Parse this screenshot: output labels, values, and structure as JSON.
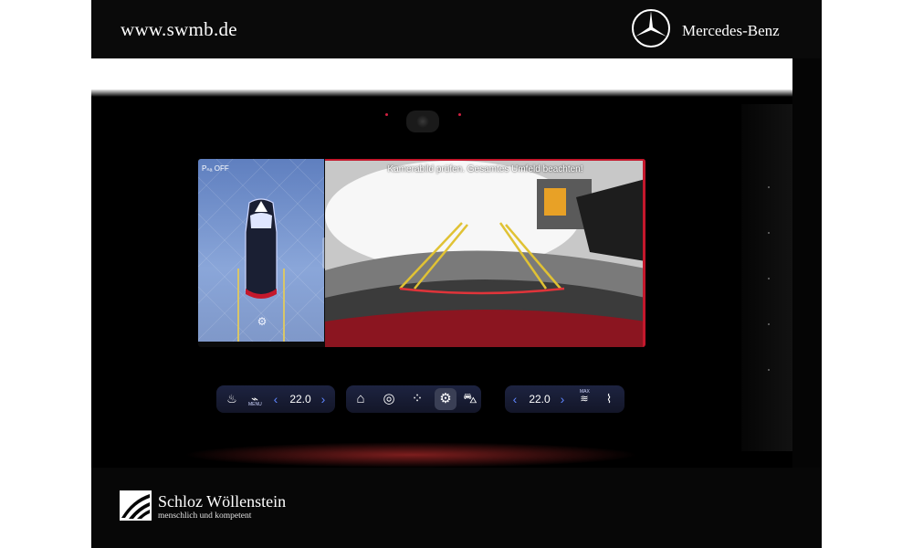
{
  "header": {
    "site_url": "www.swmb.de",
    "brand_name": "Mercedes-Benz",
    "brand_logo_icon": "three-pointed-star-icon"
  },
  "display": {
    "park_label": "Pₙₐ OFF",
    "park_assist_icon": "parking-assist-icon",
    "camera_warning": "Kamerabild prüfen. Gesamtes Umfeld beachten!",
    "toggle_icon": "chevron-left-icon",
    "accent_color": "#c4182c"
  },
  "climate": {
    "left_seat_icon": "seat-heat-icon",
    "menu_label": "MENU",
    "left_temp": "22.0",
    "right_temp": "22.0",
    "right_fan_label": "MAX",
    "right_fan_icon": "defrost-icon",
    "right_seat_icon": "seat-icon",
    "decrease_icon": "chevron-left-icon",
    "increase_icon": "chevron-right-icon"
  },
  "dock": {
    "home_icon": "home-icon",
    "color_wheel_icon": "ambient-light-icon",
    "apps_icon": "apps-icon",
    "settings_icon": "gear-icon",
    "car_icon": "car-icon"
  },
  "footer": {
    "dealer_name": "Schloz Wöllenstein",
    "dealer_slogan": "menschlich und kompetent",
    "dealer_logo_icon": "dealer-logo-icon"
  }
}
